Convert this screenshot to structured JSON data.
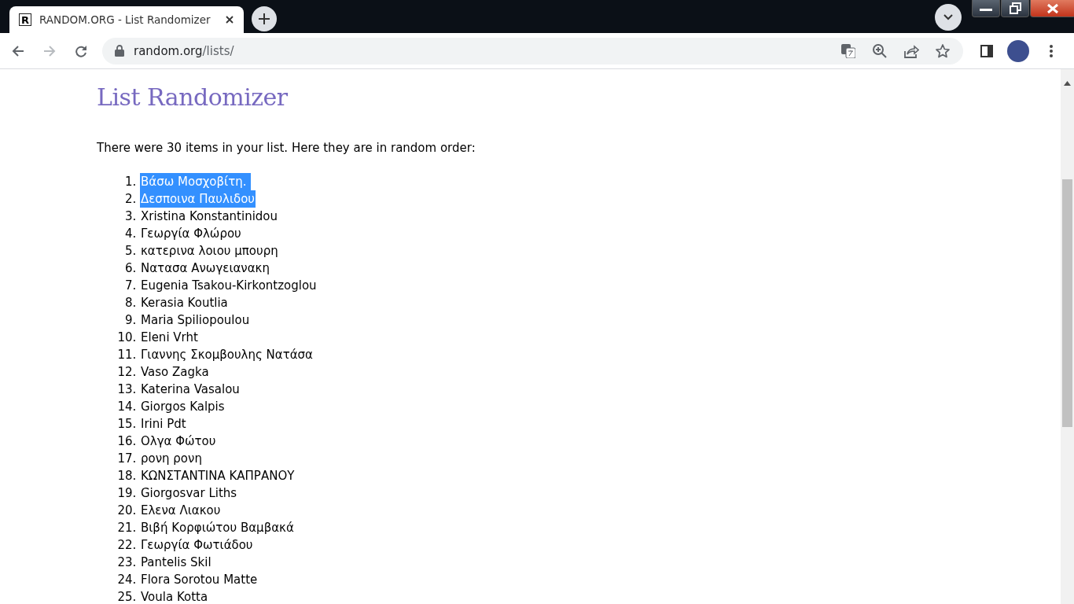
{
  "browser": {
    "tab": {
      "favicon": "R",
      "title": "RANDOM.ORG - List Randomizer"
    },
    "address": {
      "host": "random.org",
      "path": "/lists/"
    },
    "forward_button": {
      "disabled": true
    }
  },
  "page": {
    "heading": "List Randomizer",
    "intro": "There were 30 items in your list. Here they are in random order:",
    "items": [
      {
        "number": "1.",
        "text": "Βάσω Μοσχοβίτη. ",
        "selected": true
      },
      {
        "number": "2.",
        "text": "Δεσποινα Παυλιδου",
        "selected": true
      },
      {
        "number": "3.",
        "text": "Xristina Konstantinidou",
        "selected": false
      },
      {
        "number": "4.",
        "text": "Γεωργία Φλώρου",
        "selected": false
      },
      {
        "number": "5.",
        "text": "κατερινα λοιου μπουρη",
        "selected": false
      },
      {
        "number": "6.",
        "text": "Νατασα Ανωγειανακη",
        "selected": false
      },
      {
        "number": "7.",
        "text": "Eugenia Tsakou-Kirkontzoglou",
        "selected": false
      },
      {
        "number": "8.",
        "text": "Kerasia Koutlia",
        "selected": false
      },
      {
        "number": "9.",
        "text": "Maria Spiliopoulou",
        "selected": false
      },
      {
        "number": "10.",
        "text": "Eleni Vrht",
        "selected": false
      },
      {
        "number": "11.",
        "text": "Γιαννης Σκομβουλης Νατάσα",
        "selected": false
      },
      {
        "number": "12.",
        "text": "Vaso Zagka",
        "selected": false
      },
      {
        "number": "13.",
        "text": "Katerina Vasalou",
        "selected": false
      },
      {
        "number": "14.",
        "text": "Giorgos Kalpis",
        "selected": false
      },
      {
        "number": "15.",
        "text": "Irini Pdt",
        "selected": false
      },
      {
        "number": "16.",
        "text": "Ολγα Φώτου",
        "selected": false
      },
      {
        "number": "17.",
        "text": "ρονη ρονη",
        "selected": false
      },
      {
        "number": "18.",
        "text": "ΚΩΝΣΤΑΝΤΙΝΑ ΚΑΠΡΑΝΟΥ",
        "selected": false
      },
      {
        "number": "19.",
        "text": "Giorgosvar Liths",
        "selected": false
      },
      {
        "number": "20.",
        "text": "Ελενα Λιακου",
        "selected": false
      },
      {
        "number": "21.",
        "text": "Βιβή Κορφιώτου Βαμβακά",
        "selected": false
      },
      {
        "number": "22.",
        "text": "Γεωργία Φωτιάδου",
        "selected": false
      },
      {
        "number": "23.",
        "text": "Pantelis Skil",
        "selected": false
      },
      {
        "number": "24.",
        "text": "Flora Sorotou Matte",
        "selected": false
      },
      {
        "number": "25.",
        "text": "Voula Kotta",
        "selected": false
      }
    ]
  }
}
